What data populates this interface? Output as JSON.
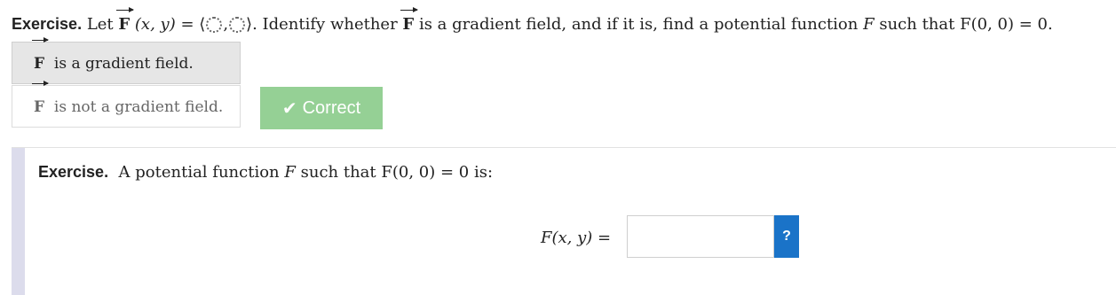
{
  "exercise1": {
    "label": "Exercise.",
    "let": "Let",
    "F": "F",
    "args": "(x, y)",
    "eq": "=",
    "open_angle": "⟨",
    "comma": ",",
    "close_angle": "⟩",
    "text_after": ". Identify whether",
    "text_end": "is a gradient field, and if it is, find a potential function",
    "F_italic": "F",
    "such_that": "such that",
    "condition": "F(0, 0) = 0."
  },
  "choices": [
    {
      "F": "F",
      "label": "is a gradient field.",
      "selected": true
    },
    {
      "F": "F",
      "label": "is not a gradient field.",
      "selected": false
    }
  ],
  "correct_button": {
    "icon": "✔",
    "label": "Correct"
  },
  "exercise2": {
    "label": "Exercise.",
    "text": "A potential function",
    "F_italic": "F",
    "such_that": "such that",
    "condition": "F(0, 0) = 0 is:"
  },
  "answer": {
    "label": "F(x, y) =",
    "value": "",
    "placeholder": "",
    "help_label": "?"
  },
  "colors": {
    "correct_bg": "#95d095",
    "help_bg": "#1a73c8",
    "selected_bg": "#e6e6e6",
    "side_bar": "#dcdcec"
  }
}
